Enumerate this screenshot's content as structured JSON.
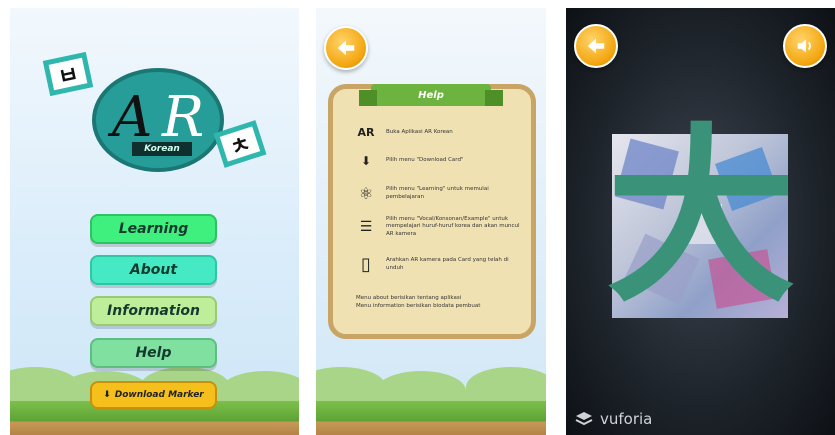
{
  "screen1": {
    "logo": {
      "letter_a": "A",
      "letter_r": "R",
      "subtitle": "Korean",
      "tile_left": "ㅂ",
      "tile_right": "ㅊ"
    },
    "menu": [
      {
        "label": "Learning",
        "color": "#3ff07e"
      },
      {
        "label": "About",
        "color": "#45e9c4"
      },
      {
        "label": "Information",
        "color": "#bfee9b"
      },
      {
        "label": "Help",
        "color": "#7fe0a0"
      }
    ],
    "download_label": "Download Marker"
  },
  "screen2": {
    "title": "Help",
    "items": [
      {
        "icon": "ar-icon",
        "glyph": "AR",
        "text": "Buka Aplikasi AR Korean"
      },
      {
        "icon": "download-icon",
        "glyph": "⬇",
        "text": "Pilih menu \"Download Card\""
      },
      {
        "icon": "atom-icon",
        "glyph": "⚛",
        "text": "Pilih menu \"Learning\" untuk memulai pembelajaran"
      },
      {
        "icon": "list-icon",
        "glyph": "☰",
        "text": "Pilih menu \"Vocal/Konsonan/Example\" untuk mempelajari huruf-huruf korea dan akan muncul AR kamera"
      },
      {
        "icon": "phone-scan-icon",
        "glyph": "▯",
        "text": "Arahkan AR kamera pada Card yang telah di unduh"
      }
    ],
    "footer": [
      "Menu about berisikan tentang aplikasi",
      "Menu information berisikan biodata pembuat"
    ]
  },
  "screen3": {
    "character": "大",
    "brand": "vuforia"
  },
  "colors": {
    "accent": "#f4a712",
    "teal": "#279d99",
    "ar_green": "#3a9378"
  }
}
